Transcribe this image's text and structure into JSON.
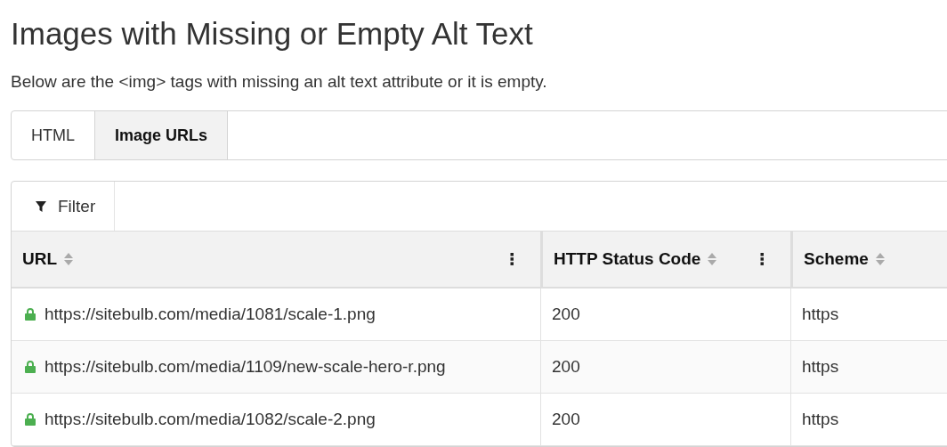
{
  "title": "Images with Missing or Empty Alt Text",
  "description": "Below are the <img> tags with missing an alt text attribute or it is empty.",
  "tabs": [
    {
      "label": "HTML",
      "selected": false
    },
    {
      "label": "Image URLs",
      "selected": true
    }
  ],
  "toolbar": {
    "filter_label": "Filter"
  },
  "table": {
    "columns": [
      "URL",
      "HTTP Status Code",
      "Scheme"
    ],
    "rows": [
      {
        "url": "https://sitebulb.com/media/1081/scale-1.png",
        "status": "200",
        "scheme": "https"
      },
      {
        "url": "https://sitebulb.com/media/1109/new-scale-hero-r.png",
        "status": "200",
        "scheme": "https"
      },
      {
        "url": "https://sitebulb.com/media/1082/scale-2.png",
        "status": "200",
        "scheme": "https"
      }
    ]
  }
}
